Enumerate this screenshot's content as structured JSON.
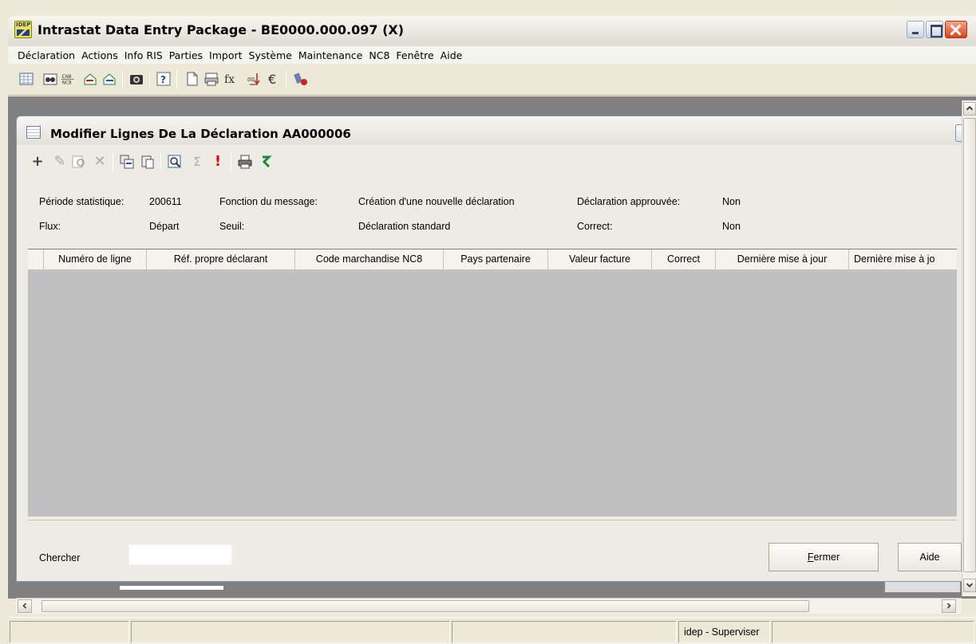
{
  "window": {
    "title": "Intrastat Data Entry Package - BE0000.000.097 (X)",
    "logo_text": "IDEP"
  },
  "menu": [
    "Déclaration",
    "Actions",
    "Info RIS",
    "Parties",
    "Import",
    "Système",
    "Maintenance",
    "NC8",
    "Fenêtre",
    "Aide"
  ],
  "toolbar": {
    "cn_label_top": "CN8",
    "cn_label_bottom": "NC8",
    "fx_label": "fx",
    "euro_label": "€"
  },
  "child_window": {
    "title": "Modifier Lignes De La Déclaration  AA000006",
    "info": {
      "periode_label": "Période statistique:",
      "periode_value": "200611",
      "fonction_label": "Fonction du message:",
      "fonction_value": "Création d'une nouvelle déclaration",
      "approuvee_label": "Déclaration approuvée:",
      "approuvee_value": "Non",
      "flux_label": "Flux:",
      "flux_value": "Départ",
      "seuil_label": "Seuil:",
      "seuil_value": "Déclaration standard",
      "correct_label": "Correct:",
      "correct_value": "Non"
    },
    "columns": [
      "Numéro de ligne",
      "Réf. propre déclarant",
      "Code marchandise NC8",
      "Pays partenaire",
      "Valeur facture",
      "Correct",
      "Dernière mise à jour",
      "Dernière mise à jo"
    ],
    "search": {
      "label": "Chercher",
      "value": ""
    },
    "buttons": {
      "fermer_first": "F",
      "fermer_rest": "ermer",
      "aide": "Aide"
    }
  },
  "statusbar": {
    "user": "idep - Superviser"
  }
}
